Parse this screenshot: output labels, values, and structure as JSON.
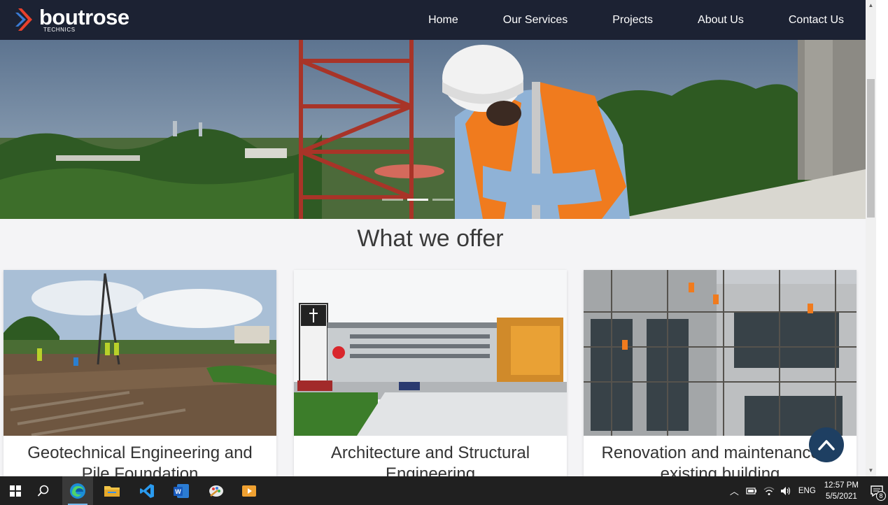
{
  "brand": {
    "name": "boutrose",
    "sub": "TECHNICS",
    "accent": "#e8412c"
  },
  "nav": {
    "items": [
      {
        "label": "Home"
      },
      {
        "label": "Our Services"
      },
      {
        "label": "Projects"
      },
      {
        "label": "About Us"
      },
      {
        "label": "Contact Us"
      }
    ]
  },
  "hero": {
    "slides": 3,
    "active_slide": 2
  },
  "section": {
    "title": "What we offer",
    "cards": [
      {
        "title": "Geotechnical Engineering and Pile Foundation"
      },
      {
        "title": "Architecture and Structural Engineering"
      },
      {
        "title": "Renovation and maintenance of existing building"
      }
    ]
  },
  "scroll_top": {
    "icon": "chevron-up-icon"
  },
  "taskbar": {
    "apps": [
      "windows-start-icon",
      "search-icon",
      "edge-icon",
      "file-explorer-icon",
      "vscode-icon",
      "word-icon",
      "paint-icon",
      "media-player-icon"
    ],
    "tray": {
      "language": "ENG",
      "time": "12:57 PM",
      "date": "5/5/2021",
      "notifications": "8"
    }
  },
  "colors": {
    "navbar": "#1c2233",
    "scroll_button": "#1e3f62",
    "taskbar": "#202020"
  }
}
